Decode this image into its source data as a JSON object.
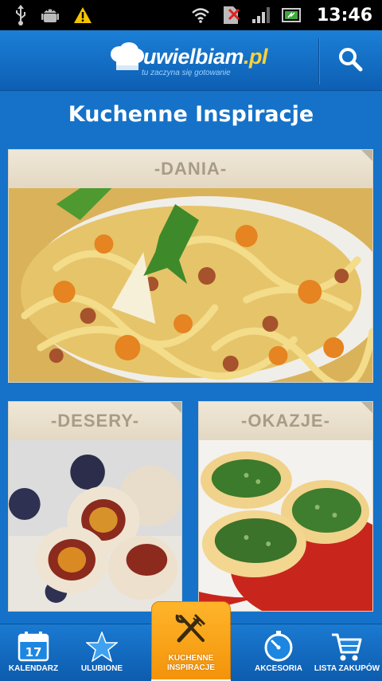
{
  "status_bar": {
    "time": "13:46",
    "icons": [
      "usb-icon",
      "android-debug-icon",
      "warning-icon",
      "wifi-icon",
      "no-sim-icon",
      "signal-icon",
      "battery-icon"
    ]
  },
  "header": {
    "logo_main": "uwielbiam",
    "logo_tld": ".pl",
    "tagline": "tu zaczyna się gotowanie",
    "search_icon": "search-icon"
  },
  "page": {
    "title": "Kuchenne Inspiracje"
  },
  "tiles": [
    {
      "label": "-DANIA-",
      "image": "pasta-dish-photo"
    },
    {
      "label": "-DESERY-",
      "image": "plum-dumplings-photo"
    },
    {
      "label": "-OKAZJE-",
      "image": "stuffed-shells-photo"
    }
  ],
  "bottom_nav": {
    "items": [
      {
        "label": "KALENDARZ",
        "icon": "calendar-icon",
        "badge": "17"
      },
      {
        "label": "ULUBIONE",
        "icon": "star-icon"
      },
      {
        "label": "KUCHENNE INSPIRACJE",
        "icon": "fork-knife-icon",
        "active": true
      },
      {
        "label": "AKCESORIA",
        "icon": "timer-icon"
      },
      {
        "label": "LISTA ZAKUPÓW",
        "icon": "cart-icon"
      }
    ]
  },
  "colors": {
    "primary_blue": "#1572c8",
    "active_orange": "#f3930a",
    "tile_label": "#a89c88",
    "logo_accent": "#fbd23a"
  }
}
